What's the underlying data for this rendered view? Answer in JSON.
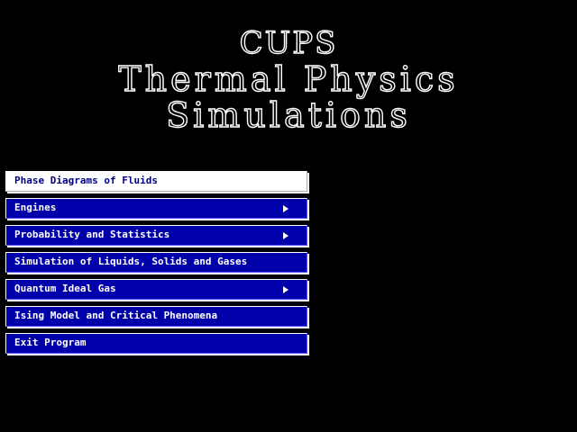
{
  "title": {
    "line1": "CUPS",
    "line2": "Thermal Physics",
    "line3": "Simulations"
  },
  "menu": {
    "items": [
      {
        "label": "Phase Diagrams of Fluids",
        "submenu": false,
        "selected": true
      },
      {
        "label": "Engines",
        "submenu": true,
        "selected": false
      },
      {
        "label": "Probability and Statistics",
        "submenu": true,
        "selected": false
      },
      {
        "label": "Simulation of Liquids, Solids and Gases",
        "submenu": false,
        "selected": false
      },
      {
        "label": "Quantum Ideal Gas",
        "submenu": true,
        "selected": false
      },
      {
        "label": "Ising Model and Critical Phenomena",
        "submenu": false,
        "selected": false
      },
      {
        "label": "Exit Program",
        "submenu": false,
        "selected": false
      }
    ],
    "submenu_icon": "triangle-right-icon"
  },
  "colors": {
    "background": "#000000",
    "button": "#0000aa",
    "selected_button": "#ffffff",
    "selected_text": "#000080",
    "text": "#ffffff"
  }
}
